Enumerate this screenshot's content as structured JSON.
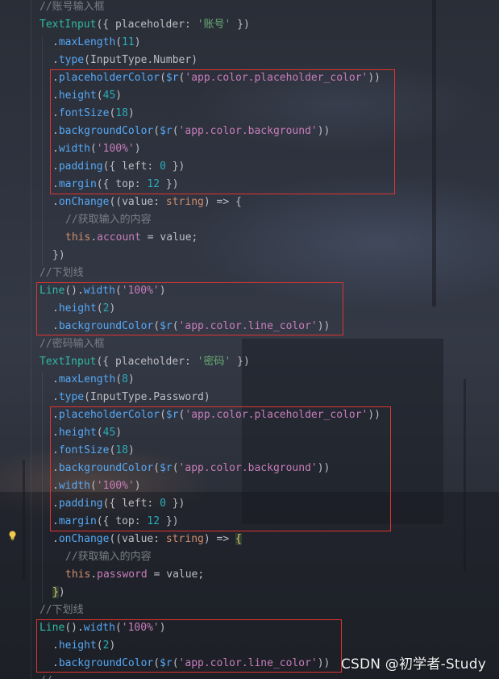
{
  "editor": {
    "lines": [
      {
        "indent": 0,
        "tokens": [
          {
            "t": "//账号输入框",
            "c": "comment"
          }
        ]
      },
      {
        "indent": 0,
        "tokens": [
          {
            "t": "TextInput",
            "c": "type"
          },
          {
            "t": "({ ",
            "c": "plain"
          },
          {
            "t": "placeholder",
            "c": "plain"
          },
          {
            "t": ": ",
            "c": "plain"
          },
          {
            "t": "'账号'",
            "c": "str"
          },
          {
            "t": " })",
            "c": "plain"
          }
        ]
      },
      {
        "indent": 1,
        "tokens": [
          {
            "t": ".",
            "c": "plain"
          },
          {
            "t": "maxLength",
            "c": "method"
          },
          {
            "t": "(",
            "c": "plain"
          },
          {
            "t": "11",
            "c": "num"
          },
          {
            "t": ")",
            "c": "plain"
          }
        ]
      },
      {
        "indent": 1,
        "tokens": [
          {
            "t": ".",
            "c": "plain"
          },
          {
            "t": "type",
            "c": "method"
          },
          {
            "t": "(InputType.Number)",
            "c": "plain"
          }
        ]
      },
      {
        "indent": 1,
        "tokens": [
          {
            "t": ".",
            "c": "plain"
          },
          {
            "t": "placeholderColor",
            "c": "method"
          },
          {
            "t": "(",
            "c": "plain"
          },
          {
            "t": "$r",
            "c": "method"
          },
          {
            "t": "(",
            "c": "plain"
          },
          {
            "t": "'app.color.placeholder_color'",
            "c": "strp"
          },
          {
            "t": "))",
            "c": "plain"
          }
        ]
      },
      {
        "indent": 1,
        "tokens": [
          {
            "t": ".",
            "c": "plain"
          },
          {
            "t": "height",
            "c": "method"
          },
          {
            "t": "(",
            "c": "plain"
          },
          {
            "t": "45",
            "c": "num"
          },
          {
            "t": ")",
            "c": "plain"
          }
        ]
      },
      {
        "indent": 1,
        "tokens": [
          {
            "t": ".",
            "c": "plain"
          },
          {
            "t": "fontSize",
            "c": "method"
          },
          {
            "t": "(",
            "c": "plain"
          },
          {
            "t": "18",
            "c": "num"
          },
          {
            "t": ")",
            "c": "plain"
          }
        ]
      },
      {
        "indent": 1,
        "tokens": [
          {
            "t": ".",
            "c": "plain"
          },
          {
            "t": "backgroundColor",
            "c": "method"
          },
          {
            "t": "(",
            "c": "plain"
          },
          {
            "t": "$r",
            "c": "method"
          },
          {
            "t": "(",
            "c": "plain"
          },
          {
            "t": "'app.color.background'",
            "c": "strp"
          },
          {
            "t": "))",
            "c": "plain"
          }
        ]
      },
      {
        "indent": 1,
        "tokens": [
          {
            "t": ".",
            "c": "plain"
          },
          {
            "t": "width",
            "c": "method"
          },
          {
            "t": "(",
            "c": "plain"
          },
          {
            "t": "'100%'",
            "c": "strp"
          },
          {
            "t": ")",
            "c": "plain"
          }
        ]
      },
      {
        "indent": 1,
        "tokens": [
          {
            "t": ".",
            "c": "plain"
          },
          {
            "t": "padding",
            "c": "method"
          },
          {
            "t": "({ ",
            "c": "plain"
          },
          {
            "t": "left",
            "c": "plain"
          },
          {
            "t": ": ",
            "c": "plain"
          },
          {
            "t": "0",
            "c": "num"
          },
          {
            "t": " })",
            "c": "plain"
          }
        ]
      },
      {
        "indent": 1,
        "tokens": [
          {
            "t": ".",
            "c": "plain"
          },
          {
            "t": "margin",
            "c": "method"
          },
          {
            "t": "({ ",
            "c": "plain"
          },
          {
            "t": "top",
            "c": "plain"
          },
          {
            "t": ": ",
            "c": "plain"
          },
          {
            "t": "12",
            "c": "num"
          },
          {
            "t": " })",
            "c": "plain"
          }
        ]
      },
      {
        "indent": 1,
        "tokens": [
          {
            "t": ".",
            "c": "plain"
          },
          {
            "t": "onChange",
            "c": "method"
          },
          {
            "t": "((value: ",
            "c": "plain"
          },
          {
            "t": "string",
            "c": "kw"
          },
          {
            "t": ") => {",
            "c": "plain"
          }
        ]
      },
      {
        "indent": 2,
        "tokens": [
          {
            "t": "//获取输入的内容",
            "c": "comment"
          }
        ]
      },
      {
        "indent": 2,
        "tokens": [
          {
            "t": "this",
            "c": "kw"
          },
          {
            "t": ".",
            "c": "plain"
          },
          {
            "t": "account",
            "c": "prop"
          },
          {
            "t": " = value;",
            "c": "plain"
          }
        ]
      },
      {
        "indent": 1,
        "tokens": [
          {
            "t": "})",
            "c": "plain"
          }
        ]
      },
      {
        "indent": 0,
        "tokens": [
          {
            "t": "//下划线",
            "c": "comment"
          }
        ]
      },
      {
        "indent": 0,
        "tokens": [
          {
            "t": "Line",
            "c": "type"
          },
          {
            "t": "().",
            "c": "plain"
          },
          {
            "t": "width",
            "c": "method"
          },
          {
            "t": "(",
            "c": "plain"
          },
          {
            "t": "'100%'",
            "c": "strp"
          },
          {
            "t": ")",
            "c": "plain"
          }
        ]
      },
      {
        "indent": 1,
        "tokens": [
          {
            "t": ".",
            "c": "plain"
          },
          {
            "t": "height",
            "c": "method"
          },
          {
            "t": "(",
            "c": "plain"
          },
          {
            "t": "2",
            "c": "num"
          },
          {
            "t": ")",
            "c": "plain"
          }
        ]
      },
      {
        "indent": 1,
        "tokens": [
          {
            "t": ".",
            "c": "plain"
          },
          {
            "t": "backgroundColor",
            "c": "method"
          },
          {
            "t": "(",
            "c": "plain"
          },
          {
            "t": "$r",
            "c": "method"
          },
          {
            "t": "(",
            "c": "plain"
          },
          {
            "t": "'app.color.line_color'",
            "c": "strp"
          },
          {
            "t": "))",
            "c": "plain"
          }
        ]
      },
      {
        "indent": 0,
        "tokens": [
          {
            "t": "//密码输入框",
            "c": "comment"
          }
        ]
      },
      {
        "indent": 0,
        "tokens": [
          {
            "t": "TextInput",
            "c": "type"
          },
          {
            "t": "({ ",
            "c": "plain"
          },
          {
            "t": "placeholder",
            "c": "plain"
          },
          {
            "t": ": ",
            "c": "plain"
          },
          {
            "t": "'密码'",
            "c": "str"
          },
          {
            "t": " })",
            "c": "plain"
          }
        ]
      },
      {
        "indent": 1,
        "tokens": [
          {
            "t": ".",
            "c": "plain"
          },
          {
            "t": "maxLength",
            "c": "method"
          },
          {
            "t": "(",
            "c": "plain"
          },
          {
            "t": "8",
            "c": "num"
          },
          {
            "t": ")",
            "c": "plain"
          }
        ]
      },
      {
        "indent": 1,
        "tokens": [
          {
            "t": ".",
            "c": "plain"
          },
          {
            "t": "type",
            "c": "method"
          },
          {
            "t": "(InputType.Password)",
            "c": "plain"
          }
        ]
      },
      {
        "indent": 1,
        "tokens": [
          {
            "t": ".",
            "c": "plain"
          },
          {
            "t": "placeholderColor",
            "c": "method"
          },
          {
            "t": "(",
            "c": "plain"
          },
          {
            "t": "$r",
            "c": "method"
          },
          {
            "t": "(",
            "c": "plain"
          },
          {
            "t": "'app.color.placeholder_color'",
            "c": "strp"
          },
          {
            "t": "))",
            "c": "plain"
          }
        ]
      },
      {
        "indent": 1,
        "tokens": [
          {
            "t": ".",
            "c": "plain"
          },
          {
            "t": "height",
            "c": "method"
          },
          {
            "t": "(",
            "c": "plain"
          },
          {
            "t": "45",
            "c": "num"
          },
          {
            "t": ")",
            "c": "plain"
          }
        ]
      },
      {
        "indent": 1,
        "tokens": [
          {
            "t": ".",
            "c": "plain"
          },
          {
            "t": "fontSize",
            "c": "method"
          },
          {
            "t": "(",
            "c": "plain"
          },
          {
            "t": "18",
            "c": "num"
          },
          {
            "t": ")",
            "c": "plain"
          }
        ]
      },
      {
        "indent": 1,
        "tokens": [
          {
            "t": ".",
            "c": "plain"
          },
          {
            "t": "backgroundColor",
            "c": "method"
          },
          {
            "t": "(",
            "c": "plain"
          },
          {
            "t": "$r",
            "c": "method"
          },
          {
            "t": "(",
            "c": "plain"
          },
          {
            "t": "'app.color.background'",
            "c": "strp"
          },
          {
            "t": "))",
            "c": "plain"
          }
        ]
      },
      {
        "indent": 1,
        "tokens": [
          {
            "t": ".",
            "c": "plain"
          },
          {
            "t": "width",
            "c": "method"
          },
          {
            "t": "(",
            "c": "plain"
          },
          {
            "t": "'100%'",
            "c": "strp"
          },
          {
            "t": ")",
            "c": "plain"
          }
        ]
      },
      {
        "indent": 1,
        "tokens": [
          {
            "t": ".",
            "c": "plain"
          },
          {
            "t": "padding",
            "c": "method"
          },
          {
            "t": "({ ",
            "c": "plain"
          },
          {
            "t": "left",
            "c": "plain"
          },
          {
            "t": ": ",
            "c": "plain"
          },
          {
            "t": "0",
            "c": "num"
          },
          {
            "t": " })",
            "c": "plain"
          }
        ]
      },
      {
        "indent": 1,
        "tokens": [
          {
            "t": ".",
            "c": "plain"
          },
          {
            "t": "margin",
            "c": "method"
          },
          {
            "t": "({ ",
            "c": "plain"
          },
          {
            "t": "top",
            "c": "plain"
          },
          {
            "t": ": ",
            "c": "plain"
          },
          {
            "t": "12",
            "c": "num"
          },
          {
            "t": " })",
            "c": "plain"
          }
        ]
      },
      {
        "indent": 1,
        "tokens": [
          {
            "t": ".",
            "c": "plain"
          },
          {
            "t": "onChange",
            "c": "method"
          },
          {
            "t": "((value: ",
            "c": "plain"
          },
          {
            "t": "string",
            "c": "kw"
          },
          {
            "t": ") => ",
            "c": "plain"
          },
          {
            "t": "{",
            "c": "bracket-hl"
          }
        ]
      },
      {
        "indent": 2,
        "tokens": [
          {
            "t": "//获取输入的内容",
            "c": "comment"
          }
        ]
      },
      {
        "indent": 2,
        "tokens": [
          {
            "t": "this",
            "c": "kw"
          },
          {
            "t": ".",
            "c": "plain"
          },
          {
            "t": "password",
            "c": "prop"
          },
          {
            "t": " = value;",
            "c": "plain"
          }
        ]
      },
      {
        "indent": 1,
        "tokens": [
          {
            "t": "}",
            "c": "bracket-hl"
          },
          {
            "t": ")",
            "c": "plain"
          }
        ]
      },
      {
        "indent": 0,
        "tokens": [
          {
            "t": "//下划线",
            "c": "comment"
          }
        ]
      },
      {
        "indent": 0,
        "tokens": [
          {
            "t": "Line",
            "c": "type"
          },
          {
            "t": "().",
            "c": "plain"
          },
          {
            "t": "width",
            "c": "method"
          },
          {
            "t": "(",
            "c": "plain"
          },
          {
            "t": "'100%'",
            "c": "strp"
          },
          {
            "t": ")",
            "c": "plain"
          }
        ]
      },
      {
        "indent": 1,
        "tokens": [
          {
            "t": ".",
            "c": "plain"
          },
          {
            "t": "height",
            "c": "method"
          },
          {
            "t": "(",
            "c": "plain"
          },
          {
            "t": "2",
            "c": "num"
          },
          {
            "t": ")",
            "c": "plain"
          }
        ]
      },
      {
        "indent": 1,
        "tokens": [
          {
            "t": ".",
            "c": "plain"
          },
          {
            "t": "backgroundColor",
            "c": "method"
          },
          {
            "t": "(",
            "c": "plain"
          },
          {
            "t": "$r",
            "c": "method"
          },
          {
            "t": "(",
            "c": "plain"
          },
          {
            "t": "'app.color.line_color'",
            "c": "strp"
          },
          {
            "t": "))",
            "c": "plain"
          }
        ]
      },
      {
        "indent": 0,
        "tokens": [
          {
            "t": "//",
            "c": "comment"
          }
        ]
      }
    ],
    "highlight_color": "#e0332f",
    "gutter_icon": "lightbulb-icon"
  },
  "watermark": {
    "text": "CSDN @初学者-Study"
  }
}
